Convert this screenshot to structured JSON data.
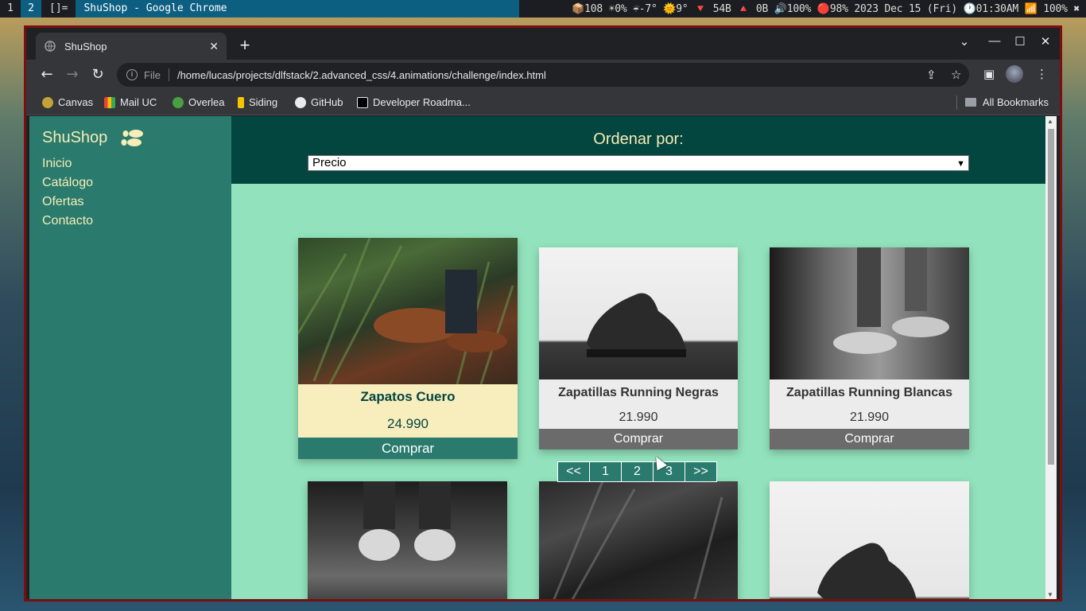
{
  "taskbar": {
    "workspaces": [
      "1",
      "2"
    ],
    "active_workspace": "2",
    "layout": "[]=",
    "window_title": "ShuShop - Google Chrome",
    "status": "📦108 ☀0% ☔-7° 🌞9° 🔻 54B 🔺 0B 🔊100% 🔴98% 2023 Dec 15 (Fri) 🕐01:30AM 📶 100% ✖"
  },
  "browser": {
    "tab_title": "ShuShop",
    "url_scheme": "File",
    "url": "/home/lucas/projects/dlfstack/2.advanced_css/4.animations/challenge/index.html",
    "bookmarks": [
      "Canvas",
      "Mail UC",
      "Overlea",
      "Siding",
      "GitHub",
      "Developer Roadma..."
    ],
    "all_bookmarks": "All Bookmarks"
  },
  "sidebar": {
    "brand": "ShuShop",
    "nav": [
      "Inicio",
      "Catálogo",
      "Ofertas",
      "Contacto"
    ]
  },
  "sort": {
    "label": "Ordenar por:",
    "selected": "Precio"
  },
  "products": [
    {
      "name": "Zapatos Cuero",
      "price": "24.990",
      "button": "Comprar"
    },
    {
      "name": "Zapatillas Running Negras",
      "price": "21.990",
      "button": "Comprar"
    },
    {
      "name": "Zapatillas Running Blancas",
      "price": "21.990",
      "button": "Comprar"
    }
  ],
  "pager": [
    "<<",
    "1",
    "2",
    "3",
    ">>"
  ],
  "colors": {
    "sidebar_bg": "#2a7a6e",
    "header_bg": "#03453f",
    "main_bg": "#92e3bd",
    "accent_text": "#f6edb7"
  }
}
